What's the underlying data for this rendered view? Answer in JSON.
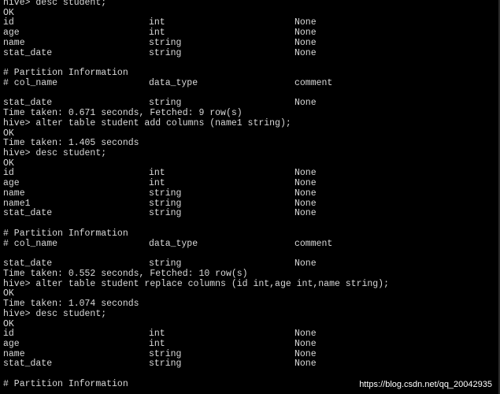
{
  "terminal": {
    "lines": [
      {
        "text": "hive> desc student;"
      },
      {
        "text": "OK"
      },
      {
        "cols": [
          "id",
          "int",
          "None"
        ]
      },
      {
        "cols": [
          "age",
          "int",
          "None"
        ]
      },
      {
        "cols": [
          "name",
          "string",
          "None"
        ]
      },
      {
        "cols": [
          "stat_date",
          "string",
          "None"
        ]
      },
      {
        "text": ""
      },
      {
        "text": "# Partition Information"
      },
      {
        "cols": [
          "# col_name",
          "data_type",
          "comment"
        ]
      },
      {
        "text": ""
      },
      {
        "cols": [
          "stat_date",
          "string",
          "None"
        ]
      },
      {
        "text": "Time taken: 0.671 seconds, Fetched: 9 row(s)"
      },
      {
        "text": "hive> alter table student add columns (name1 string);"
      },
      {
        "text": "OK"
      },
      {
        "text": "Time taken: 1.405 seconds"
      },
      {
        "text": "hive> desc student;"
      },
      {
        "text": "OK"
      },
      {
        "cols": [
          "id",
          "int",
          "None"
        ]
      },
      {
        "cols": [
          "age",
          "int",
          "None"
        ]
      },
      {
        "cols": [
          "name",
          "string",
          "None"
        ]
      },
      {
        "cols": [
          "name1",
          "string",
          "None"
        ]
      },
      {
        "cols": [
          "stat_date",
          "string",
          "None"
        ]
      },
      {
        "text": ""
      },
      {
        "text": "# Partition Information"
      },
      {
        "cols": [
          "# col_name",
          "data_type",
          "comment"
        ]
      },
      {
        "text": ""
      },
      {
        "cols": [
          "stat_date",
          "string",
          "None"
        ]
      },
      {
        "text": "Time taken: 0.552 seconds, Fetched: 10 row(s)"
      },
      {
        "text": "hive> alter table student replace columns (id int,age int,name string);"
      },
      {
        "text": "OK"
      },
      {
        "text": "Time taken: 1.074 seconds"
      },
      {
        "text": "hive> desc student;"
      },
      {
        "text": "OK"
      },
      {
        "cols": [
          "id",
          "int",
          "None"
        ]
      },
      {
        "cols": [
          "age",
          "int",
          "None"
        ]
      },
      {
        "cols": [
          "name",
          "string",
          "None"
        ]
      },
      {
        "cols": [
          "stat_date",
          "string",
          "None"
        ]
      },
      {
        "text": ""
      },
      {
        "text": "# Partition Information"
      }
    ]
  },
  "watermark": "https://blog.csdn.net/qq_20042935",
  "colors": {
    "background": "#000000",
    "text": "#d9d9d9"
  }
}
